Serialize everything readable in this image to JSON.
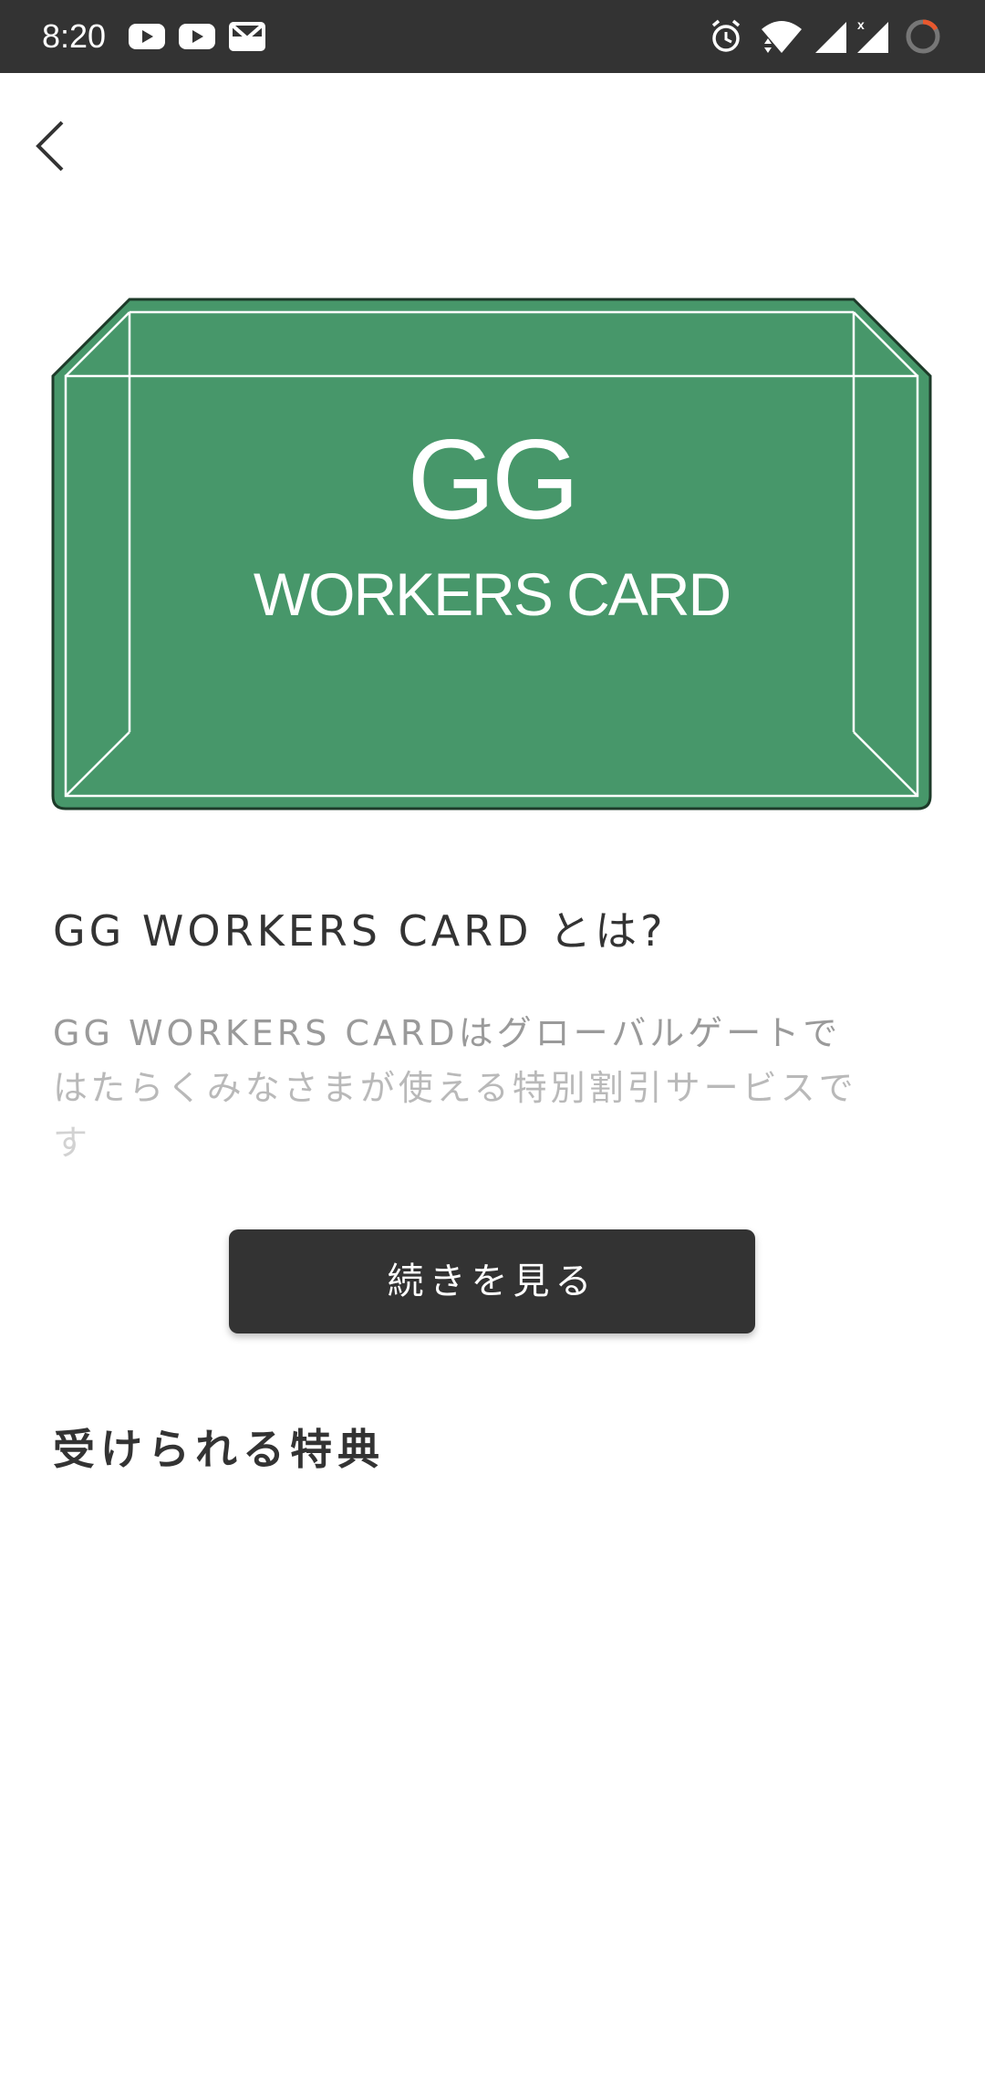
{
  "status_bar": {
    "time": "8:20",
    "icons": [
      "youtube-icon",
      "youtube-icon",
      "gmail-icon",
      "alarm-icon",
      "wifi-icon",
      "signal-icon",
      "signal-icon",
      "loading-icon"
    ],
    "background": "#333333"
  },
  "nav": {
    "back_icon": "chevron-left-icon"
  },
  "card": {
    "title": "GG",
    "subtitle": "WORKERS CARD",
    "color": "#47976A"
  },
  "about": {
    "heading": "GG WORKERS CARD とは?",
    "description_lines": [
      "GG WORKERS CARDはグローバルゲートで",
      "はたらくみなさまが使える特別割引サービスで",
      "す"
    ]
  },
  "more_button": {
    "label": "続きを見る",
    "color": "#333333"
  },
  "benefits": {
    "heading": "受けられる特典"
  }
}
